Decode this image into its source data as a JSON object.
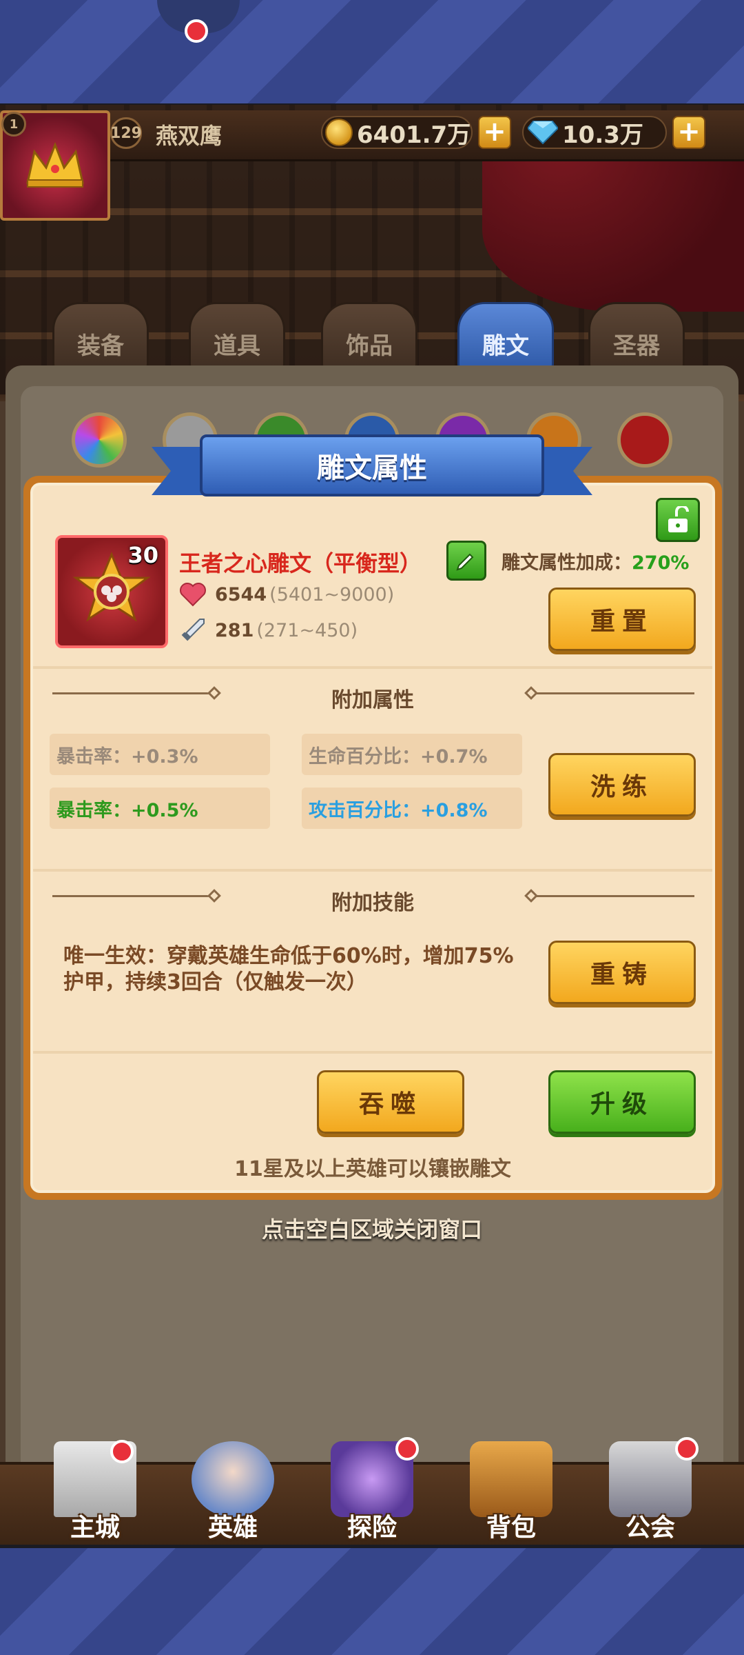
{
  "player": {
    "vip_level": "1",
    "level": "129",
    "name": "燕双鹰",
    "gold": "6401.7万",
    "diamonds": "10.3万"
  },
  "tabs": [
    {
      "label": "装备",
      "active": false
    },
    {
      "label": "道具",
      "active": false
    },
    {
      "label": "饰品",
      "active": false
    },
    {
      "label": "雕文",
      "active": true
    },
    {
      "label": "圣器",
      "active": false
    }
  ],
  "dialog": {
    "title": "雕文属性",
    "rune": {
      "level": "30",
      "name": "王者之心雕文（平衡型）",
      "hp_value": "6544",
      "hp_range": "(5401~9000)",
      "atk_value": "281",
      "atk_range": "(271~450)"
    },
    "bonus_label": "雕文属性加成：",
    "bonus_value": "270%",
    "reset_label": "重置",
    "extra_attr_title": "附加属性",
    "attrs": [
      {
        "text": "暴击率：+0.3%",
        "color": "gray"
      },
      {
        "text": "生命百分比：+0.7%",
        "color": "gray"
      },
      {
        "text": "暴击率：+0.5%",
        "color": "green"
      },
      {
        "text": "攻击百分比：+0.8%",
        "color": "blue"
      }
    ],
    "refine_label": "洗练",
    "extra_skill_title": "附加技能",
    "skill_text": "唯一生效：穿戴英雄生命低于60%时，增加75%护甲，持续3回合（仅触发一次）",
    "recast_label": "重铸",
    "devour_label": "吞噬",
    "upgrade_label": "升级",
    "hint": "11星及以上英雄可以镶嵌雕文"
  },
  "close_hint": "点击空白区域关闭窗口",
  "bottom_nav": [
    {
      "label": "主城",
      "icon": "castle-icon",
      "badge": true
    },
    {
      "label": "英雄",
      "icon": "hero-icon",
      "badge": false
    },
    {
      "label": "探险",
      "icon": "portal-icon",
      "badge": true
    },
    {
      "label": "背包",
      "icon": "bag-icon",
      "badge": false
    },
    {
      "label": "公会",
      "icon": "guild-icon",
      "badge": true
    }
  ],
  "colors": {
    "accent_blue": "#2f5db4",
    "button_yellow": "#f2a81e",
    "button_green": "#48b01c",
    "rune_name_red": "#d8271d",
    "bonus_green": "#27a01c"
  }
}
